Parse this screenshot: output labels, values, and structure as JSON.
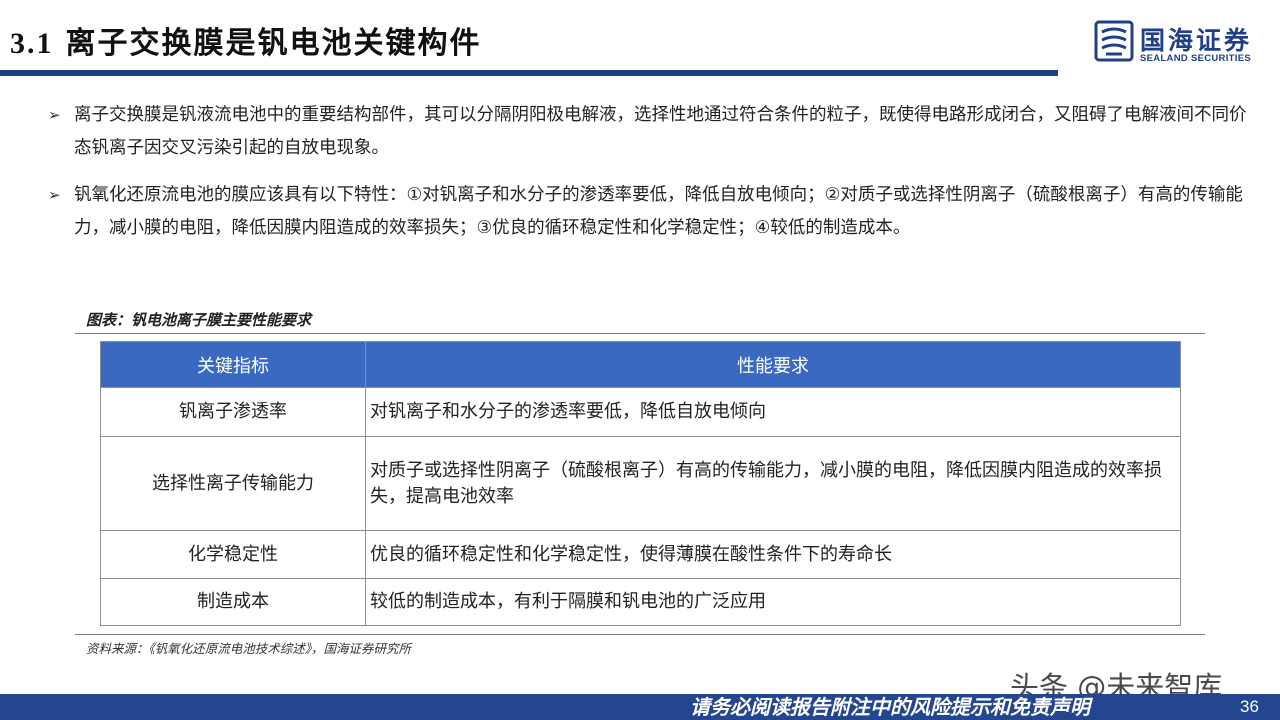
{
  "header": {
    "number": "3.1",
    "title": "离子交换膜是钒电池关键构件",
    "logo_cn": "国海证券",
    "logo_en": "SEALAND SECURITIES"
  },
  "bullets": [
    "离子交换膜是钒液流电池中的重要结构部件，其可以分隔阴阳极电解液，选择性地通过符合条件的粒子，既使得电路形成闭合，又阻碍了电解液间不同价态钒离子因交叉污染引起的自放电现象。",
    "钒氧化还原流电池的膜应该具有以下特性：①对钒离子和水分子的渗透率要低，降低自放电倾向；②对质子或选择性阴离子（硫酸根离子）有高的传输能力，减小膜的电阻，降低因膜内阻造成的效率损失；③优良的循环稳定性和化学稳定性；④较低的制造成本。"
  ],
  "caption": "图表：钒电池离子膜主要性能要求",
  "table": {
    "headers": [
      "关键指标",
      "性能要求"
    ],
    "rows": [
      {
        "key": "钒离子渗透率",
        "value": "对钒离子和水分子的渗透率要低，降低自放电倾向"
      },
      {
        "key": "选择性离子传输能力",
        "value": "对质子或选择性阴离子（硫酸根离子）有高的传输能力，减小膜的电阻，降低因膜内阻造成的效率损失，提高电池效率"
      },
      {
        "key": "化学稳定性",
        "value": "优良的循环稳定性和化学稳定性，使得薄膜在酸性条件下的寿命长"
      },
      {
        "key": "制造成本",
        "value": "较低的制造成本，有利于隔膜和钒电池的广泛应用"
      }
    ]
  },
  "source": "资料来源：《钒氧化还原流电池技术综述》，国海证券研究所",
  "watermark": "头条 @未来智库",
  "footer": {
    "disclaimer": "请务必阅读报告附注中的风险提示和免责声明",
    "page": "36"
  },
  "colors": {
    "brand": "#1f3f86",
    "table_header": "#3a69c2",
    "footer": "#23468e"
  }
}
